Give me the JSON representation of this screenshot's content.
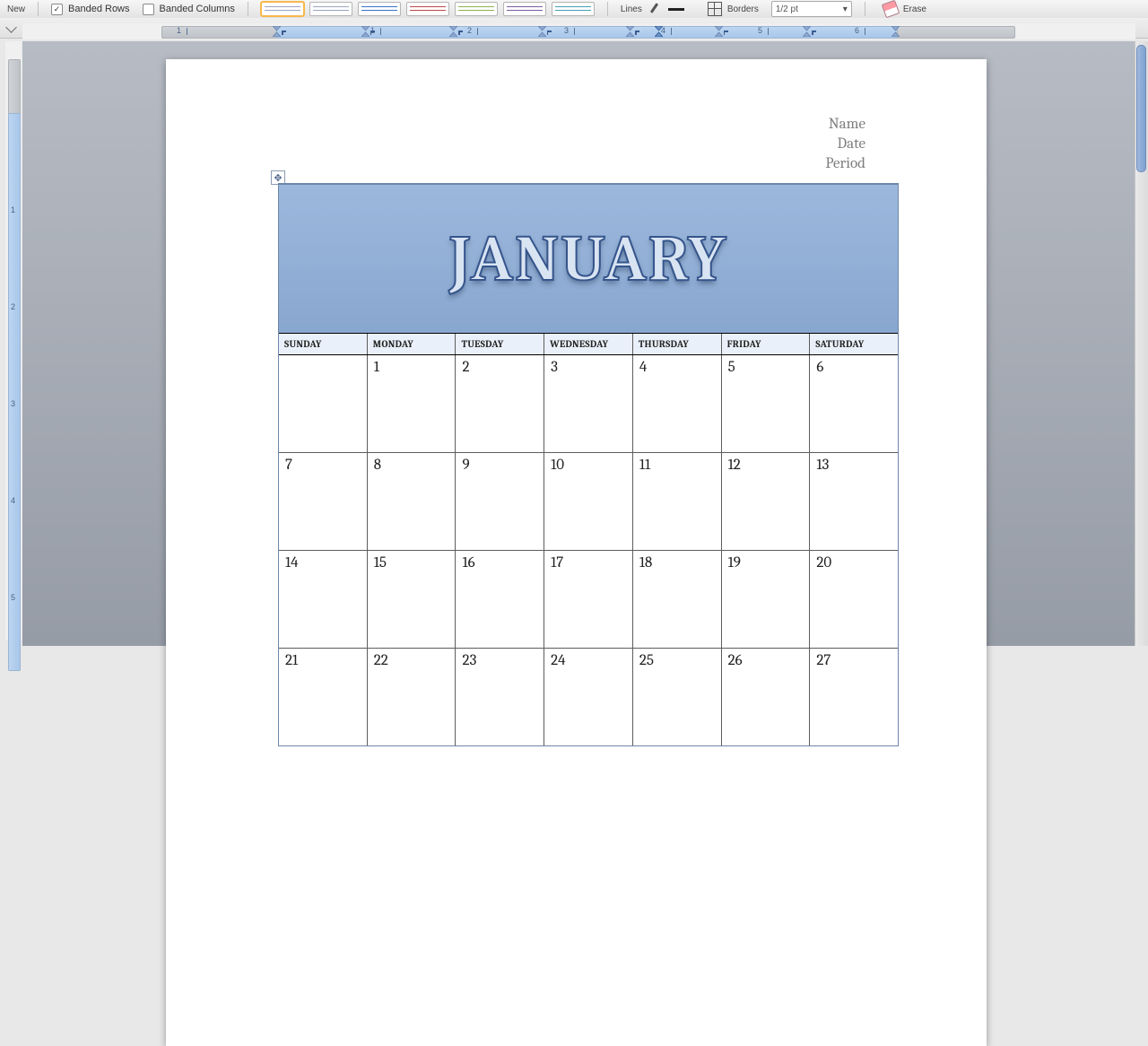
{
  "toolbar": {
    "new_label": "New",
    "banded_rows_label": "Banded Rows",
    "banded_rows_checked": "✓",
    "banded_cols_label": "Banded Columns",
    "lines_label": "Lines",
    "borders_label": "Borders",
    "pt_value": "1/2 pt",
    "erase_label": "Erase"
  },
  "ruler": {
    "numbers": [
      "1",
      "1",
      "2",
      "3",
      "4",
      "5",
      "6"
    ],
    "v_numbers": [
      "1",
      "2",
      "3",
      "4",
      "5"
    ]
  },
  "header": {
    "name": "Name",
    "date": "Date",
    "period": "Period"
  },
  "calendar": {
    "title": "JANUARY",
    "days": [
      "SUNDAY",
      "MONDAY",
      "TUESDAY",
      "WEDNESDAY",
      "THURSDAY",
      "FRIDAY",
      "SATURDAY"
    ],
    "weeks": [
      [
        "",
        "1",
        "2",
        "3",
        "4",
        "5",
        "6"
      ],
      [
        "7",
        "8",
        "9",
        "10",
        "11",
        "12",
        "13"
      ],
      [
        "14",
        "15",
        "16",
        "17",
        "18",
        "19",
        "20"
      ],
      [
        "21",
        "22",
        "23",
        "24",
        "25",
        "26",
        "27"
      ]
    ]
  },
  "move_handle_glyph": "✥"
}
